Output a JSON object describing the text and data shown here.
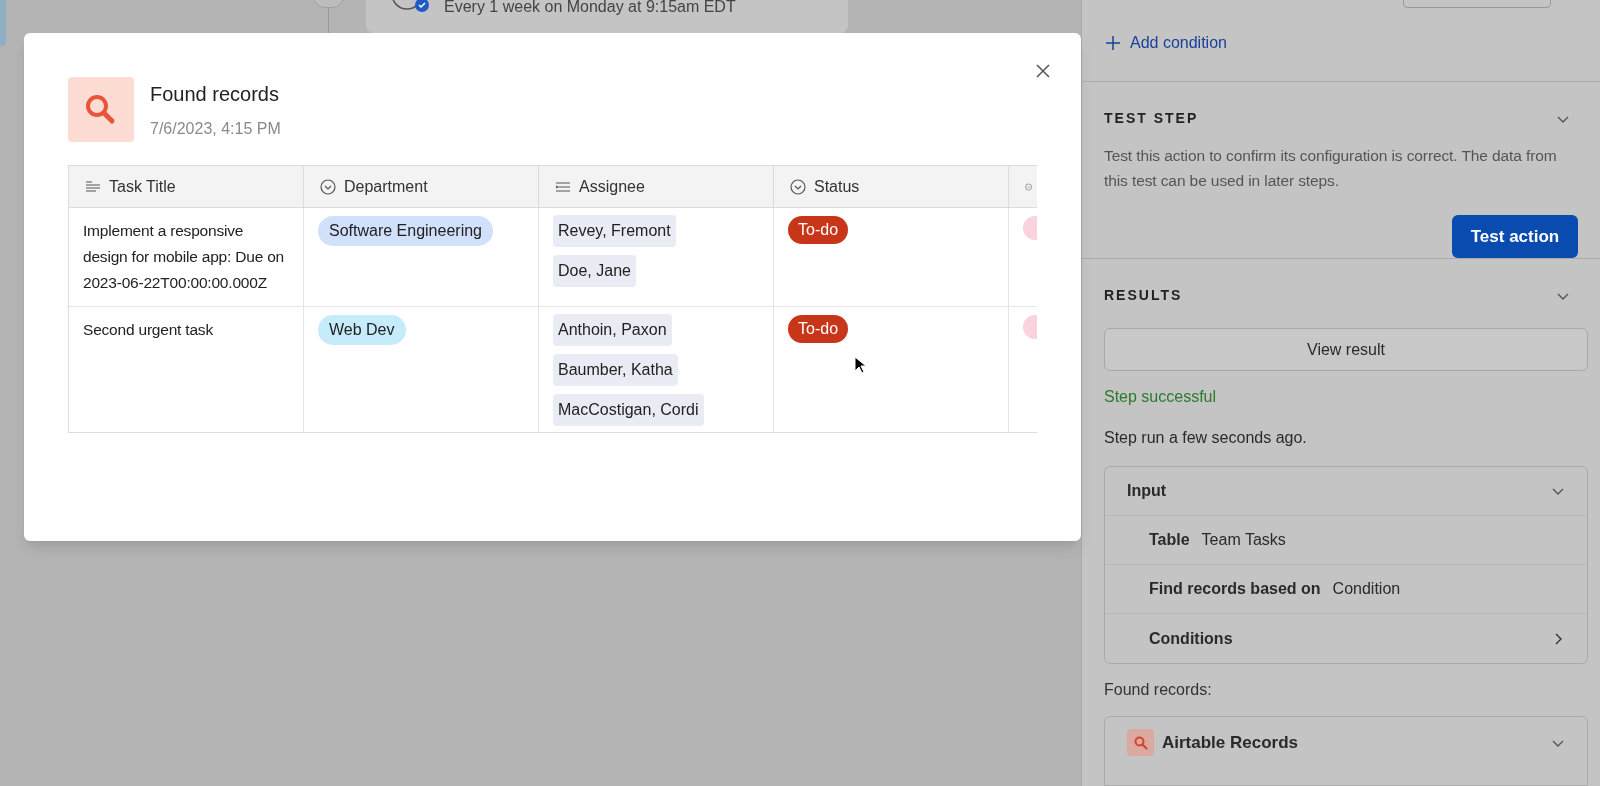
{
  "background": {
    "schedule_text": "Every 1 week on Monday at 9:15am EDT"
  },
  "modal": {
    "title": "Found records",
    "timestamp": "7/6/2023, 4:15 PM",
    "table": {
      "columns": [
        {
          "label": "Task Title",
          "kind": "text"
        },
        {
          "label": "Department",
          "kind": "select"
        },
        {
          "label": "Assignee",
          "kind": "list"
        },
        {
          "label": "Status",
          "kind": "select"
        },
        {
          "kind": "select"
        }
      ],
      "rows": [
        {
          "task_title": "Implement a responsive design for mobile app: Due on 2023-06-22T00:00:00.000Z",
          "department": {
            "label": "Software Engineering",
            "color": "#d1e0fb"
          },
          "assignees": [
            "Revey, Fremont",
            "Doe, Jane"
          ],
          "status": {
            "label": "To-do",
            "color": "#c8361a"
          },
          "column_5": {
            "color": "#fbd3dc"
          }
        },
        {
          "task_title": "Second urgent task",
          "department": {
            "label": "Web Dev",
            "color": "#c6ecfb"
          },
          "assignees": [
            "Anthoin, Paxon",
            "Baumber, Katha",
            "MacCostigan, Cordi"
          ],
          "status": {
            "label": "To-do",
            "color": "#c8361a"
          },
          "column_5": {
            "color": "#fbd3dc"
          }
        }
      ]
    }
  },
  "right_panel": {
    "add_condition": "Add condition",
    "test_step": {
      "heading": "TEST STEP",
      "description": "Test this action to confirm its configuration is correct. The data from this test can be used in later steps.",
      "button": "Test action"
    },
    "results": {
      "heading": "RESULTS",
      "button": "View result",
      "status": "Step successful",
      "run_time": "Step run a few seconds ago.",
      "input": {
        "title": "Input",
        "expanded": true,
        "rows": [
          {
            "kind": "field",
            "label": "Table",
            "value": "Team Tasks"
          },
          {
            "kind": "field",
            "label": "Find records based on",
            "value": "Condition"
          },
          {
            "kind": "link",
            "label": "Conditions"
          }
        ]
      },
      "found_label": "Found records:",
      "found_item": "Airtable Records"
    }
  }
}
